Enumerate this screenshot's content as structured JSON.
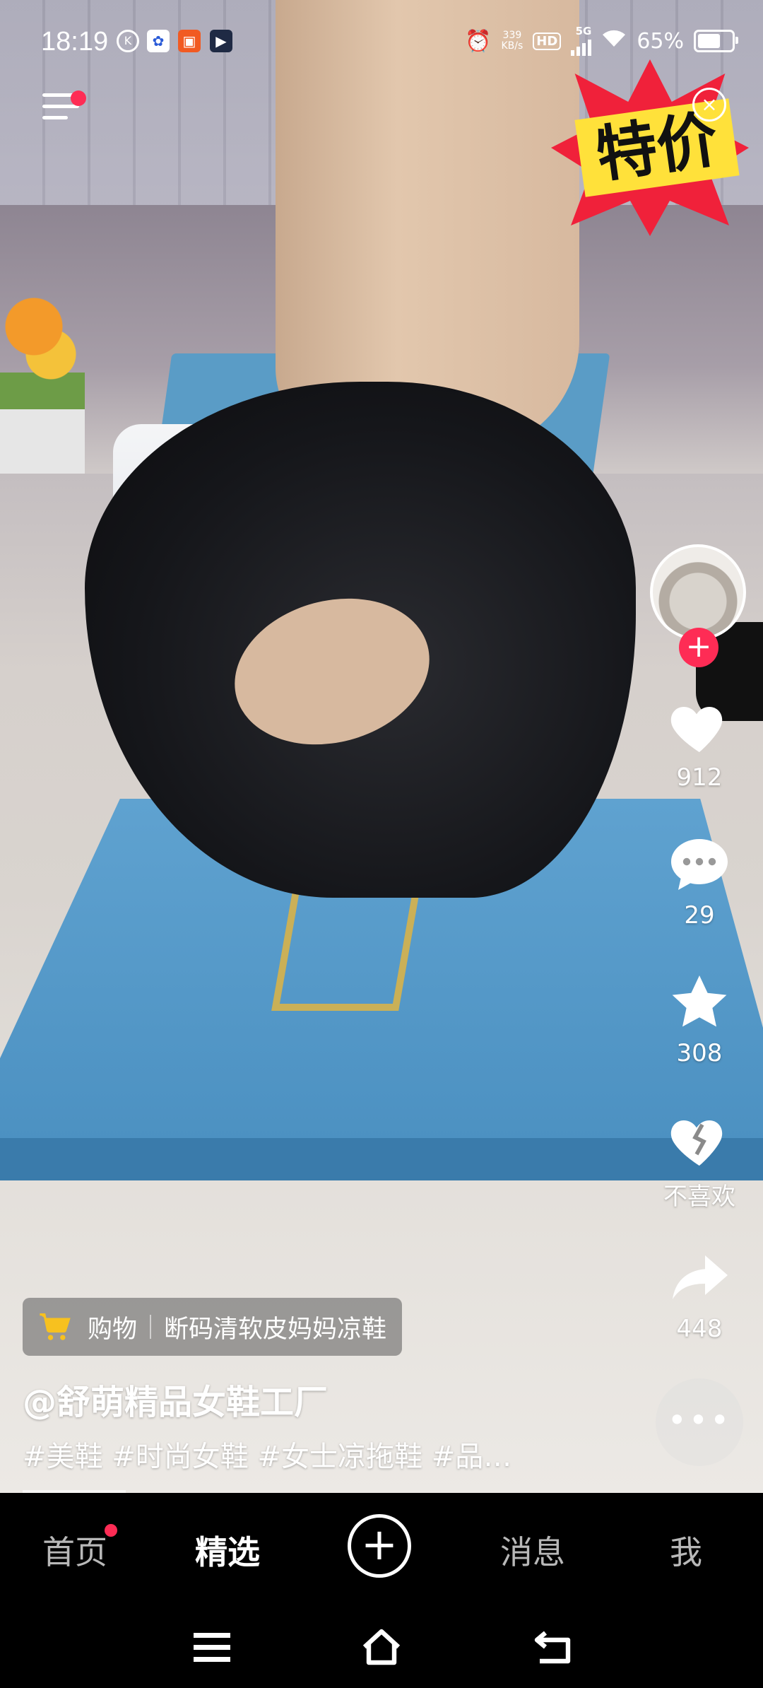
{
  "status_bar": {
    "time": "18:19",
    "net_speed_value": "339",
    "net_speed_unit": "KB/s",
    "hd": "HD",
    "network": "5G",
    "battery": "65%"
  },
  "promo": {
    "badge_text": "特价"
  },
  "actions": {
    "likes": "912",
    "comments": "29",
    "favorites": "308",
    "dislike_label": "不喜欢",
    "shares": "448",
    "more": "•••",
    "follow": "+"
  },
  "video_info": {
    "shop_tag_label": "购物",
    "shop_tag_product": "断码清软皮妈妈凉鞋",
    "author": "@舒萌精品女鞋工厂",
    "description": "#美鞋 #时尚女鞋 #女士凉拖鞋 #品…"
  },
  "bottom_nav": {
    "tabs": [
      "首页",
      "精选",
      "消息",
      "我"
    ],
    "plus": "+"
  },
  "colors": {
    "accent": "#fe2c55",
    "tab_bar_bg": "#000000"
  }
}
